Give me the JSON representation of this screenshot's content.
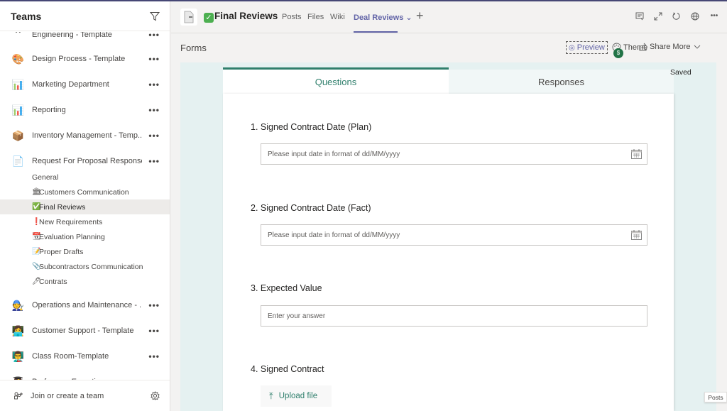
{
  "sidebar": {
    "title": "Teams",
    "teams": [
      {
        "name": "Engineering - Template",
        "icon": "chevron-up-icon",
        "glyph": "⌃"
      },
      {
        "name": "Design Process - Template",
        "icon": "palette-icon",
        "glyph": "🎨"
      },
      {
        "name": "Marketing Department",
        "icon": "bar-chart-icon",
        "glyph": "📊"
      },
      {
        "name": "Reporting",
        "icon": "bar-chart-icon",
        "glyph": "📊"
      },
      {
        "name": "Inventory Management - Temp...",
        "icon": "package-icon",
        "glyph": "📦"
      },
      {
        "name": "Request For Proposal Response...",
        "icon": "document-icon",
        "glyph": "📄"
      },
      {
        "name": "Operations and Maintenance - ...",
        "icon": "person-icon",
        "glyph": "🧑‍🔧"
      },
      {
        "name": "Customer Support - Template",
        "icon": "person-laptop-icon",
        "glyph": "👩‍💻"
      },
      {
        "name": "Class Room-Template",
        "icon": "teacher-icon",
        "glyph": "👨‍🏫"
      },
      {
        "name": "Professors Expertise",
        "icon": "person-icon",
        "glyph": "👩‍🎓"
      }
    ],
    "channels": [
      {
        "name": "General",
        "glyph": ""
      },
      {
        "name": "Customers Communication",
        "glyph": "🏛"
      },
      {
        "name": "Final Reviews",
        "glyph": "✅"
      },
      {
        "name": "New Requirements",
        "glyph": "❗"
      },
      {
        "name": "Evaluation Planning",
        "glyph": "📆"
      },
      {
        "name": "Proper Drafts",
        "glyph": "📝"
      },
      {
        "name": "Subcontractors Communication",
        "glyph": "📎"
      },
      {
        "name": "Contrats",
        "glyph": "🖊"
      }
    ],
    "more_label": "•••",
    "footer": {
      "join_label": "Join or create a team"
    }
  },
  "header": {
    "channel_title": "Final Reviews",
    "title_glyph": "✓",
    "tabs": [
      {
        "label": "Posts"
      },
      {
        "label": "Files"
      },
      {
        "label": "Wiki"
      },
      {
        "label": "Deal Reviews ⌄"
      }
    ],
    "add_tab": "+",
    "more_label": "•••"
  },
  "toolbar": {
    "app_label": "Forms",
    "preview_label": "Preview",
    "theme_label": "Theme",
    "share_label": "Share More"
  },
  "form": {
    "tabs": {
      "questions": "Questions",
      "responses": "Responses"
    },
    "status": "Saved",
    "questions": [
      {
        "title": "1. Signed Contract Date (Plan)",
        "placeholder": "Please input date in format of dd/MM/yyyy",
        "type": "date"
      },
      {
        "title": "2. Signed Contract Date (Fact)",
        "placeholder": "Please input date in format of dd/MM/yyyy",
        "type": "date"
      },
      {
        "title": "3. Expected Value",
        "placeholder": "Enter your answer",
        "type": "text"
      },
      {
        "title": "4. Signed Contract",
        "type": "file",
        "button_label": "Upload file"
      }
    ]
  },
  "tooltip": "Posts",
  "colors": {
    "accent": "#6264a7",
    "forms_green": "#2f7f6c",
    "forms_bg": "#e5f1f1"
  }
}
